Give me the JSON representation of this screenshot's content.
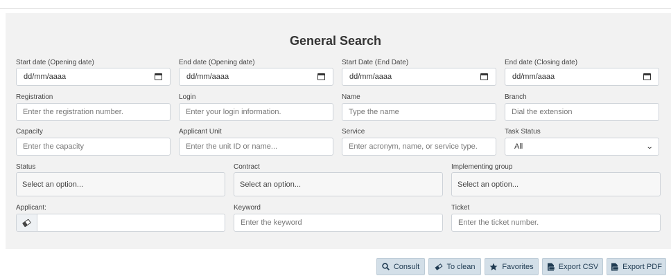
{
  "title": "General Search",
  "fields": {
    "start_opening": {
      "label": "Start date (Opening date)",
      "value": "dd/mm/aaaa"
    },
    "end_opening": {
      "label": "End date (Opening date)",
      "value": "dd/mm/aaaa"
    },
    "start_end": {
      "label": "Start Date (End Date)",
      "value": "dd/mm/aaaa"
    },
    "end_closing": {
      "label": "End date (Closing date)",
      "value": "dd/mm/aaaa"
    },
    "registration": {
      "label": "Registration",
      "placeholder": "Enter the registration number."
    },
    "login": {
      "label": "Login",
      "placeholder": "Enter your login information."
    },
    "name": {
      "label": "Name",
      "placeholder": "Type the name"
    },
    "branch": {
      "label": "Branch",
      "placeholder": "Dial the extension"
    },
    "capacity": {
      "label": "Capacity",
      "placeholder": "Enter the capacity"
    },
    "applicant_unit": {
      "label": "Applicant Unit",
      "placeholder": "Enter the unit ID or name..."
    },
    "service": {
      "label": "Service",
      "placeholder": "Enter acronym, name, or service type."
    },
    "task_status": {
      "label": "Task Status",
      "value": "All"
    },
    "status": {
      "label": "Status",
      "value": "Select an option..."
    },
    "contract": {
      "label": "Contract",
      "value": "Select an option..."
    },
    "implementing_group": {
      "label": "Implementing group",
      "value": "Select an option..."
    },
    "applicant": {
      "label": "Applicant:",
      "value": ""
    },
    "keyword": {
      "label": "Keyword",
      "placeholder": "Enter the keyword"
    },
    "ticket": {
      "label": "Ticket",
      "placeholder": "Enter the ticket number."
    }
  },
  "buttons": {
    "consult": "Consult",
    "clean": "To clean",
    "favorites": "Favorites",
    "export_csv": "Export CSV",
    "export_pdf": "Export PDF"
  },
  "icons": {
    "consult": "search-icon",
    "clean": "eraser-icon",
    "favorites": "star-icon",
    "export_csv": "csv-file-icon",
    "export_pdf": "pdf-file-icon",
    "date": "calendar-icon"
  },
  "colors": {
    "panel": "#f2f2f2",
    "button_bg": "#d3dfe8",
    "button_text": "#1f3b52"
  }
}
